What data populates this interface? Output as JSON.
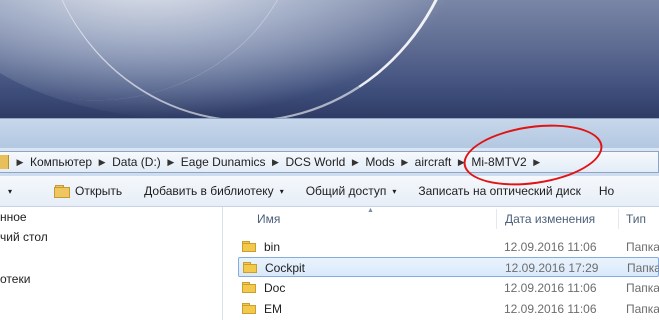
{
  "address": {
    "breadcrumbs": [
      "Компьютер",
      "Data (D:)",
      "Eage Dunamics",
      "DCS World",
      "Mods",
      "aircraft",
      "Mi-8MTV2"
    ]
  },
  "toolbar": {
    "organize_arrow": "▾",
    "open_label": "Открыть",
    "library_label": "Добавить в библиотеку",
    "share_label": "Общий доступ",
    "burn_label": "Записать на оптический диск",
    "new_label": "Но"
  },
  "nav": {
    "items": [
      "нное",
      "чий стол",
      "",
      "отеки"
    ]
  },
  "files": {
    "columns": {
      "name": "Имя",
      "date": "Дата изменения",
      "type": "Тип"
    },
    "rows": [
      {
        "name": "bin",
        "date": "12.09.2016 11:06",
        "type": "Папка"
      },
      {
        "name": "Cockpit",
        "date": "12.09.2016 17:29",
        "type": "Папка",
        "selected": true
      },
      {
        "name": "Doc",
        "date": "12.09.2016 11:06",
        "type": "Папка"
      },
      {
        "name": "EM",
        "date": "12.09.2016 11:06",
        "type": "Папка"
      }
    ]
  },
  "colors": {
    "annotation": "#e01414",
    "selection_border": "#84acdd"
  }
}
